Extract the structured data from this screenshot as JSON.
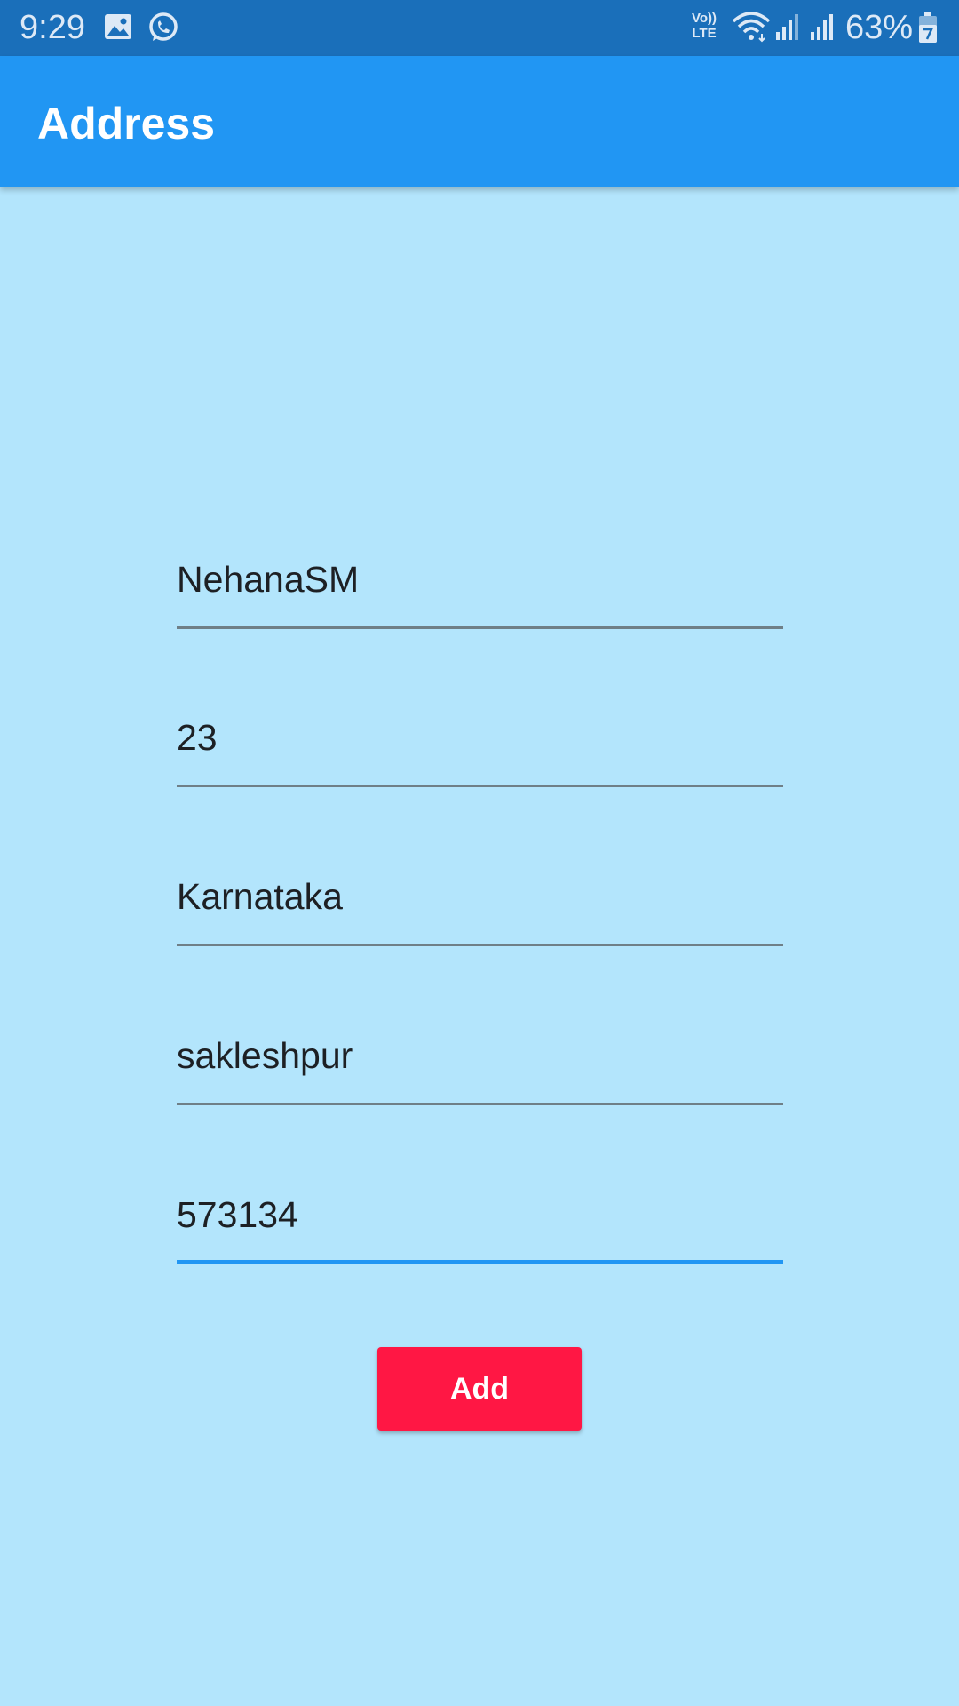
{
  "status_bar": {
    "time": "9:29",
    "lte_top": "Vo))",
    "lte_bottom": "LTE",
    "battery_percent": "63%",
    "icons": [
      "image-icon",
      "whatsapp-icon",
      "volte-icon",
      "wifi-icon",
      "signal-icon",
      "signal-icon",
      "battery-icon"
    ]
  },
  "app_bar": {
    "title": "Address"
  },
  "form": {
    "fields": [
      {
        "value": "NehanaSM"
      },
      {
        "value": "23"
      },
      {
        "value": "Karnataka"
      },
      {
        "value": "sakleshpur"
      },
      {
        "value": "573134"
      }
    ],
    "add_label": "Add"
  },
  "colors": {
    "status_bar": "#1a6fba",
    "app_bar": "#2196f3",
    "background": "#b3e5fc",
    "button": "#ff1744",
    "focused_underline": "#2196f3"
  }
}
